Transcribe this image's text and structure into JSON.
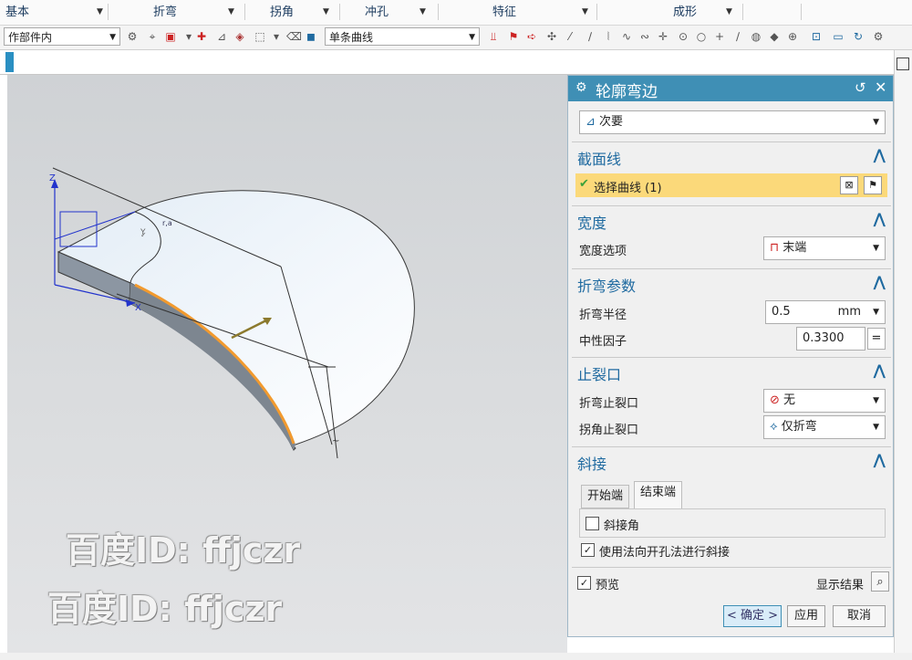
{
  "ribbon": {
    "groups": [
      "基本",
      "折弯",
      "拐角",
      "冲孔",
      "特征",
      "成形"
    ]
  },
  "toolbar": {
    "filter_value": "作部件内",
    "curve_rule_value": "单条曲线"
  },
  "dialog": {
    "title": "轮廓弯边",
    "type_value": "次要",
    "sections": {
      "section_curve": {
        "title": "截面线",
        "select_curve_label": "选择曲线 (1)"
      },
      "width": {
        "title": "宽度",
        "width_option_label": "宽度选项",
        "width_option_value": "末端"
      },
      "bend_params": {
        "title": "折弯参数",
        "bend_radius_label": "折弯半径",
        "bend_radius_value": "0.5",
        "bend_radius_unit": "mm",
        "neutral_factor_label": "中性因子",
        "neutral_factor_value": "0.3300",
        "eq_label": "="
      },
      "relief": {
        "title": "止裂口",
        "bend_relief_label": "折弯止裂口",
        "bend_relief_value": "无",
        "corner_relief_label": "拐角止裂口",
        "corner_relief_value": "仅折弯"
      },
      "miter": {
        "title": "斜接",
        "tabs": [
          "开始端",
          "结束端"
        ],
        "miter_angle_label": "斜接角",
        "use_normal_label": "使用法向开孔法进行斜接"
      }
    },
    "preview_label": "预览",
    "show_result_label": "显示结果",
    "buttons": {
      "ok": "< 确定 >",
      "apply": "应用",
      "cancel": "取消"
    }
  },
  "viewport": {
    "watermark_lines": [
      "百度ID: ffjczr",
      "百度ID: ffjczr"
    ],
    "axis_z": "Z",
    "axis_y": "Y",
    "axis_x": "X"
  }
}
